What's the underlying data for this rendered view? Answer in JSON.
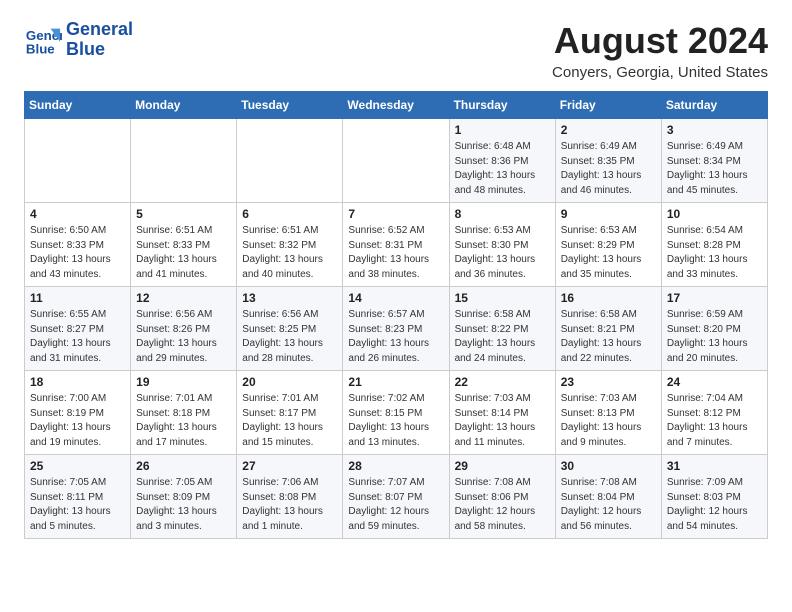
{
  "header": {
    "logo_line1": "General",
    "logo_line2": "Blue",
    "month": "August 2024",
    "location": "Conyers, Georgia, United States"
  },
  "weekdays": [
    "Sunday",
    "Monday",
    "Tuesday",
    "Wednesday",
    "Thursday",
    "Friday",
    "Saturday"
  ],
  "weeks": [
    [
      {
        "day": "",
        "sunrise": "",
        "sunset": "",
        "daylight": ""
      },
      {
        "day": "",
        "sunrise": "",
        "sunset": "",
        "daylight": ""
      },
      {
        "day": "",
        "sunrise": "",
        "sunset": "",
        "daylight": ""
      },
      {
        "day": "",
        "sunrise": "",
        "sunset": "",
        "daylight": ""
      },
      {
        "day": "1",
        "sunrise": "Sunrise: 6:48 AM",
        "sunset": "Sunset: 8:36 PM",
        "daylight": "Daylight: 13 hours and 48 minutes."
      },
      {
        "day": "2",
        "sunrise": "Sunrise: 6:49 AM",
        "sunset": "Sunset: 8:35 PM",
        "daylight": "Daylight: 13 hours and 46 minutes."
      },
      {
        "day": "3",
        "sunrise": "Sunrise: 6:49 AM",
        "sunset": "Sunset: 8:34 PM",
        "daylight": "Daylight: 13 hours and 45 minutes."
      }
    ],
    [
      {
        "day": "4",
        "sunrise": "Sunrise: 6:50 AM",
        "sunset": "Sunset: 8:33 PM",
        "daylight": "Daylight: 13 hours and 43 minutes."
      },
      {
        "day": "5",
        "sunrise": "Sunrise: 6:51 AM",
        "sunset": "Sunset: 8:33 PM",
        "daylight": "Daylight: 13 hours and 41 minutes."
      },
      {
        "day": "6",
        "sunrise": "Sunrise: 6:51 AM",
        "sunset": "Sunset: 8:32 PM",
        "daylight": "Daylight: 13 hours and 40 minutes."
      },
      {
        "day": "7",
        "sunrise": "Sunrise: 6:52 AM",
        "sunset": "Sunset: 8:31 PM",
        "daylight": "Daylight: 13 hours and 38 minutes."
      },
      {
        "day": "8",
        "sunrise": "Sunrise: 6:53 AM",
        "sunset": "Sunset: 8:30 PM",
        "daylight": "Daylight: 13 hours and 36 minutes."
      },
      {
        "day": "9",
        "sunrise": "Sunrise: 6:53 AM",
        "sunset": "Sunset: 8:29 PM",
        "daylight": "Daylight: 13 hours and 35 minutes."
      },
      {
        "day": "10",
        "sunrise": "Sunrise: 6:54 AM",
        "sunset": "Sunset: 8:28 PM",
        "daylight": "Daylight: 13 hours and 33 minutes."
      }
    ],
    [
      {
        "day": "11",
        "sunrise": "Sunrise: 6:55 AM",
        "sunset": "Sunset: 8:27 PM",
        "daylight": "Daylight: 13 hours and 31 minutes."
      },
      {
        "day": "12",
        "sunrise": "Sunrise: 6:56 AM",
        "sunset": "Sunset: 8:26 PM",
        "daylight": "Daylight: 13 hours and 29 minutes."
      },
      {
        "day": "13",
        "sunrise": "Sunrise: 6:56 AM",
        "sunset": "Sunset: 8:25 PM",
        "daylight": "Daylight: 13 hours and 28 minutes."
      },
      {
        "day": "14",
        "sunrise": "Sunrise: 6:57 AM",
        "sunset": "Sunset: 8:23 PM",
        "daylight": "Daylight: 13 hours and 26 minutes."
      },
      {
        "day": "15",
        "sunrise": "Sunrise: 6:58 AM",
        "sunset": "Sunset: 8:22 PM",
        "daylight": "Daylight: 13 hours and 24 minutes."
      },
      {
        "day": "16",
        "sunrise": "Sunrise: 6:58 AM",
        "sunset": "Sunset: 8:21 PM",
        "daylight": "Daylight: 13 hours and 22 minutes."
      },
      {
        "day": "17",
        "sunrise": "Sunrise: 6:59 AM",
        "sunset": "Sunset: 8:20 PM",
        "daylight": "Daylight: 13 hours and 20 minutes."
      }
    ],
    [
      {
        "day": "18",
        "sunrise": "Sunrise: 7:00 AM",
        "sunset": "Sunset: 8:19 PM",
        "daylight": "Daylight: 13 hours and 19 minutes."
      },
      {
        "day": "19",
        "sunrise": "Sunrise: 7:01 AM",
        "sunset": "Sunset: 8:18 PM",
        "daylight": "Daylight: 13 hours and 17 minutes."
      },
      {
        "day": "20",
        "sunrise": "Sunrise: 7:01 AM",
        "sunset": "Sunset: 8:17 PM",
        "daylight": "Daylight: 13 hours and 15 minutes."
      },
      {
        "day": "21",
        "sunrise": "Sunrise: 7:02 AM",
        "sunset": "Sunset: 8:15 PM",
        "daylight": "Daylight: 13 hours and 13 minutes."
      },
      {
        "day": "22",
        "sunrise": "Sunrise: 7:03 AM",
        "sunset": "Sunset: 8:14 PM",
        "daylight": "Daylight: 13 hours and 11 minutes."
      },
      {
        "day": "23",
        "sunrise": "Sunrise: 7:03 AM",
        "sunset": "Sunset: 8:13 PM",
        "daylight": "Daylight: 13 hours and 9 minutes."
      },
      {
        "day": "24",
        "sunrise": "Sunrise: 7:04 AM",
        "sunset": "Sunset: 8:12 PM",
        "daylight": "Daylight: 13 hours and 7 minutes."
      }
    ],
    [
      {
        "day": "25",
        "sunrise": "Sunrise: 7:05 AM",
        "sunset": "Sunset: 8:11 PM",
        "daylight": "Daylight: 13 hours and 5 minutes."
      },
      {
        "day": "26",
        "sunrise": "Sunrise: 7:05 AM",
        "sunset": "Sunset: 8:09 PM",
        "daylight": "Daylight: 13 hours and 3 minutes."
      },
      {
        "day": "27",
        "sunrise": "Sunrise: 7:06 AM",
        "sunset": "Sunset: 8:08 PM",
        "daylight": "Daylight: 13 hours and 1 minute."
      },
      {
        "day": "28",
        "sunrise": "Sunrise: 7:07 AM",
        "sunset": "Sunset: 8:07 PM",
        "daylight": "Daylight: 12 hours and 59 minutes."
      },
      {
        "day": "29",
        "sunrise": "Sunrise: 7:08 AM",
        "sunset": "Sunset: 8:06 PM",
        "daylight": "Daylight: 12 hours and 58 minutes."
      },
      {
        "day": "30",
        "sunrise": "Sunrise: 7:08 AM",
        "sunset": "Sunset: 8:04 PM",
        "daylight": "Daylight: 12 hours and 56 minutes."
      },
      {
        "day": "31",
        "sunrise": "Sunrise: 7:09 AM",
        "sunset": "Sunset: 8:03 PM",
        "daylight": "Daylight: 12 hours and 54 minutes."
      }
    ]
  ]
}
